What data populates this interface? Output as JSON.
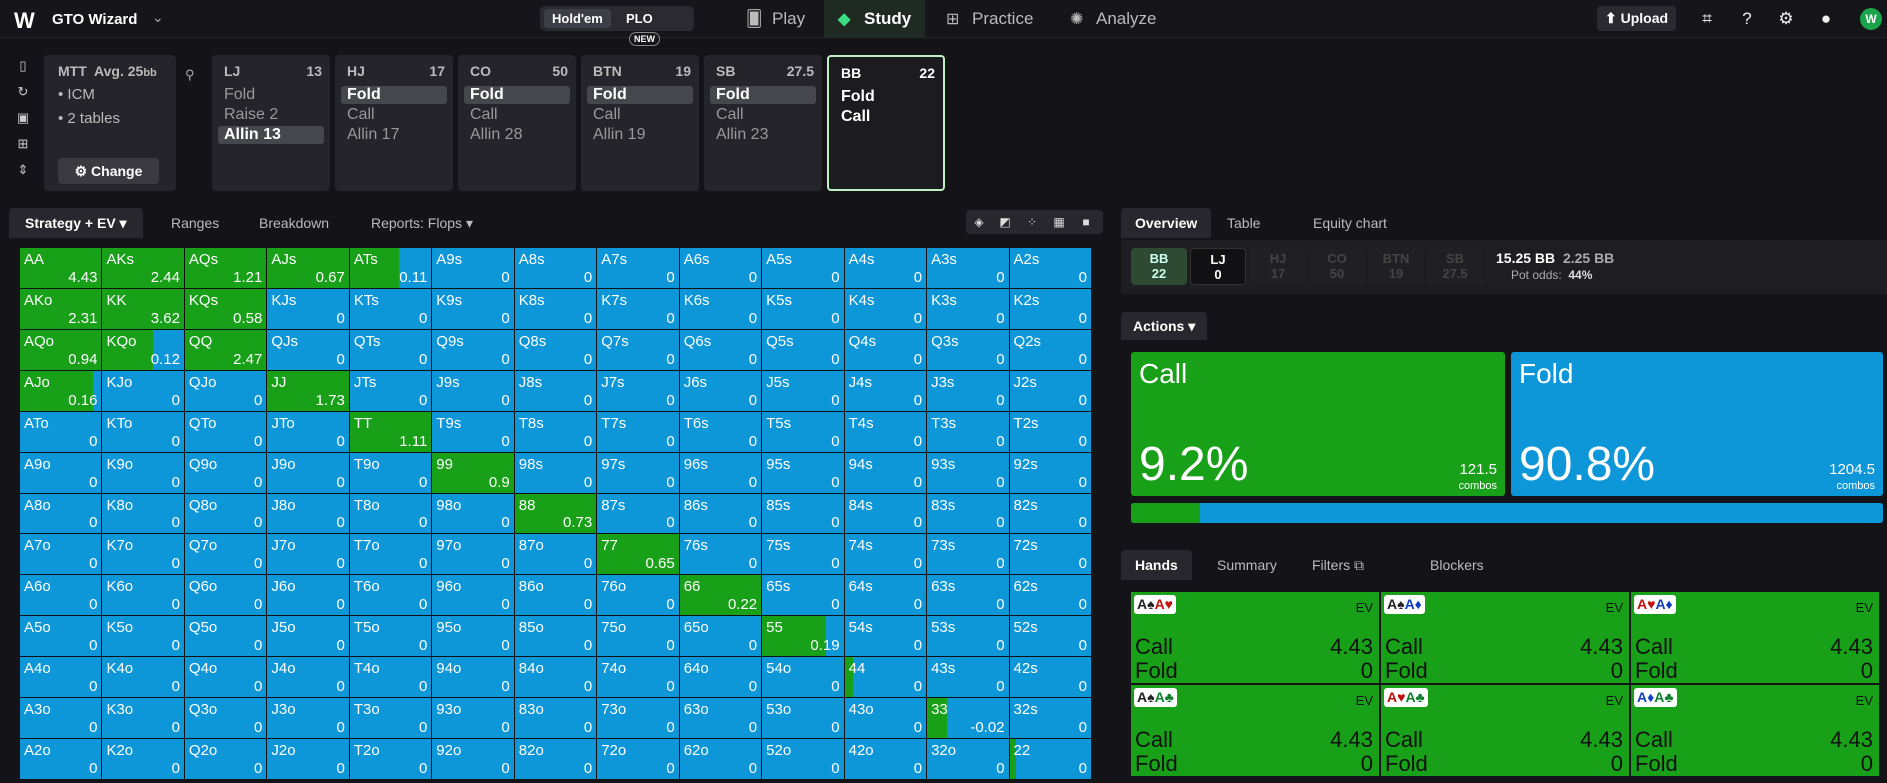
{
  "app": {
    "logo": "W",
    "name": "GTO Wizard"
  },
  "game_toggle": {
    "holdem": "Hold'em",
    "plo": "PLO",
    "new_badge": "NEW"
  },
  "nav": [
    {
      "label": "Play",
      "icon": "cards-icon"
    },
    {
      "label": "Study",
      "icon": "graduation-cap-icon"
    },
    {
      "label": "Practice",
      "icon": "gamepad-icon"
    },
    {
      "label": "Analyze",
      "icon": "lightbulb-icon"
    }
  ],
  "upload_label": "Upload",
  "avatar_initial": "W",
  "tournament": {
    "title": "MTT",
    "avg": "Avg. 25",
    "avg_unit": "bb",
    "bullets": [
      "ICM",
      "2 tables"
    ],
    "change_label": "Change"
  },
  "positions": [
    {
      "name": "LJ",
      "stack": "13",
      "actions": [
        "Fold",
        "Raise 2",
        "Allin 13"
      ],
      "selected": 2
    },
    {
      "name": "HJ",
      "stack": "17",
      "actions": [
        "Fold",
        "Call",
        "Allin 17"
      ],
      "selected": 0
    },
    {
      "name": "CO",
      "stack": "50",
      "actions": [
        "Fold",
        "Call",
        "Allin 28"
      ],
      "selected": 0
    },
    {
      "name": "BTN",
      "stack": "19",
      "actions": [
        "Fold",
        "Call",
        "Allin 19"
      ],
      "selected": 0
    },
    {
      "name": "SB",
      "stack": "27.5",
      "actions": [
        "Fold",
        "Call",
        "Allin 23"
      ],
      "selected": 0
    },
    {
      "name": "BB",
      "stack": "22",
      "actions": [
        "Fold",
        "Call"
      ],
      "selected": -1,
      "current": true
    }
  ],
  "left_tabs": [
    "Strategy + EV",
    "Ranges",
    "Breakdown",
    "Reports: Flops"
  ],
  "grid": {
    "hands": [
      [
        "AA",
        "AKs",
        "AQs",
        "AJs",
        "ATs",
        "A9s",
        "A8s",
        "A7s",
        "A6s",
        "A5s",
        "A4s",
        "A3s",
        "A2s"
      ],
      [
        "AKo",
        "KK",
        "KQs",
        "KJs",
        "KTs",
        "K9s",
        "K8s",
        "K7s",
        "K6s",
        "K5s",
        "K4s",
        "K3s",
        "K2s"
      ],
      [
        "AQo",
        "KQo",
        "QQ",
        "QJs",
        "QTs",
        "Q9s",
        "Q8s",
        "Q7s",
        "Q6s",
        "Q5s",
        "Q4s",
        "Q3s",
        "Q2s"
      ],
      [
        "AJo",
        "KJo",
        "QJo",
        "JJ",
        "JTs",
        "J9s",
        "J8s",
        "J7s",
        "J6s",
        "J5s",
        "J4s",
        "J3s",
        "J2s"
      ],
      [
        "ATo",
        "KTo",
        "QTo",
        "JTo",
        "TT",
        "T9s",
        "T8s",
        "T7s",
        "T6s",
        "T5s",
        "T4s",
        "T3s",
        "T2s"
      ],
      [
        "A9o",
        "K9o",
        "Q9o",
        "J9o",
        "T9o",
        "99",
        "98s",
        "97s",
        "96s",
        "95s",
        "94s",
        "93s",
        "92s"
      ],
      [
        "A8o",
        "K8o",
        "Q8o",
        "J8o",
        "T8o",
        "98o",
        "88",
        "87s",
        "86s",
        "85s",
        "84s",
        "83s",
        "82s"
      ],
      [
        "A7o",
        "K7o",
        "Q7o",
        "J7o",
        "T7o",
        "97o",
        "87o",
        "77",
        "76s",
        "75s",
        "74s",
        "73s",
        "72s"
      ],
      [
        "A6o",
        "K6o",
        "Q6o",
        "J6o",
        "T6o",
        "96o",
        "86o",
        "76o",
        "66",
        "65s",
        "64s",
        "63s",
        "62s"
      ],
      [
        "A5o",
        "K5o",
        "Q5o",
        "J5o",
        "T5o",
        "95o",
        "85o",
        "75o",
        "65o",
        "55",
        "54s",
        "53s",
        "52s"
      ],
      [
        "A4o",
        "K4o",
        "Q4o",
        "J4o",
        "T4o",
        "94o",
        "84o",
        "74o",
        "64o",
        "54o",
        "44",
        "43s",
        "42s"
      ],
      [
        "A3o",
        "K3o",
        "Q3o",
        "J3o",
        "T3o",
        "93o",
        "83o",
        "73o",
        "63o",
        "53o",
        "43o",
        "33",
        "32s"
      ],
      [
        "A2o",
        "K2o",
        "Q2o",
        "J2o",
        "T2o",
        "92o",
        "82o",
        "72o",
        "62o",
        "52o",
        "42o",
        "32o",
        "22"
      ]
    ],
    "ev": [
      [
        "4.43",
        "2.44",
        "1.21",
        "0.67",
        "0.11",
        "0",
        "0",
        "0",
        "0",
        "0",
        "0",
        "0",
        "0"
      ],
      [
        "2.31",
        "3.62",
        "0.58",
        "0",
        "0",
        "0",
        "0",
        "0",
        "0",
        "0",
        "0",
        "0",
        "0"
      ],
      [
        "0.94",
        "0.12",
        "2.47",
        "0",
        "0",
        "0",
        "0",
        "0",
        "0",
        "0",
        "0",
        "0",
        "0"
      ],
      [
        "0.16",
        "0",
        "0",
        "1.73",
        "0",
        "0",
        "0",
        "0",
        "0",
        "0",
        "0",
        "0",
        "0"
      ],
      [
        "0",
        "0",
        "0",
        "0",
        "1.11",
        "0",
        "0",
        "0",
        "0",
        "0",
        "0",
        "0",
        "0"
      ],
      [
        "0",
        "0",
        "0",
        "0",
        "0",
        "0.9",
        "0",
        "0",
        "0",
        "0",
        "0",
        "0",
        "0"
      ],
      [
        "0",
        "0",
        "0",
        "0",
        "0",
        "0",
        "0.73",
        "0",
        "0",
        "0",
        "0",
        "0",
        "0"
      ],
      [
        "0",
        "0",
        "0",
        "0",
        "0",
        "0",
        "0",
        "0.65",
        "0",
        "0",
        "0",
        "0",
        "0"
      ],
      [
        "0",
        "0",
        "0",
        "0",
        "0",
        "0",
        "0",
        "0",
        "0.22",
        "0",
        "0",
        "0",
        "0"
      ],
      [
        "0",
        "0",
        "0",
        "0",
        "0",
        "0",
        "0",
        "0",
        "0",
        "0.19",
        "0",
        "0",
        "0"
      ],
      [
        "0",
        "0",
        "0",
        "0",
        "0",
        "0",
        "0",
        "0",
        "0",
        "0",
        "0",
        "0",
        "0"
      ],
      [
        "0",
        "0",
        "0",
        "0",
        "0",
        "0",
        "0",
        "0",
        "0",
        "0",
        "0",
        "-0.02",
        "0"
      ],
      [
        "0",
        "0",
        "0",
        "0",
        "0",
        "0",
        "0",
        "0",
        "0",
        "0",
        "0",
        "0",
        "0"
      ]
    ],
    "call_freq": [
      [
        1,
        1,
        1,
        1,
        0.6,
        0,
        0,
        0,
        0,
        0,
        0,
        0,
        0
      ],
      [
        1,
        1,
        1,
        0,
        0,
        0,
        0,
        0,
        0,
        0,
        0,
        0,
        0
      ],
      [
        1,
        0.62,
        1,
        0,
        0,
        0,
        0,
        0,
        0,
        0,
        0,
        0,
        0
      ],
      [
        0.9,
        0,
        0,
        1,
        0,
        0,
        0,
        0,
        0,
        0,
        0,
        0,
        0
      ],
      [
        0,
        0,
        0,
        0,
        1,
        0,
        0,
        0,
        0,
        0,
        0,
        0,
        0
      ],
      [
        0,
        0,
        0,
        0,
        0,
        1,
        0,
        0,
        0,
        0,
        0,
        0,
        0
      ],
      [
        0,
        0,
        0,
        0,
        0,
        0,
        1,
        0,
        0,
        0,
        0,
        0,
        0
      ],
      [
        0,
        0,
        0,
        0,
        0,
        0,
        0,
        1,
        0,
        0,
        0,
        0,
        0
      ],
      [
        0,
        0,
        0,
        0,
        0,
        0,
        0,
        0,
        1,
        0,
        0,
        0,
        0
      ],
      [
        0,
        0,
        0,
        0,
        0,
        0,
        0,
        0,
        0,
        0.78,
        0,
        0,
        0
      ],
      [
        0,
        0,
        0,
        0,
        0,
        0,
        0,
        0,
        0,
        0,
        0.1,
        0,
        0
      ],
      [
        0,
        0,
        0,
        0,
        0,
        0,
        0,
        0,
        0,
        0,
        0,
        0.25,
        0
      ],
      [
        0,
        0,
        0,
        0,
        0,
        0,
        0,
        0,
        0,
        0,
        0,
        0,
        0.08
      ]
    ]
  },
  "right_tabs": [
    "Overview",
    "Table",
    "Equity chart"
  ],
  "chips": [
    {
      "name": "BB",
      "value": "22"
    },
    {
      "name": "LJ",
      "value": "0"
    },
    {
      "name": "HJ",
      "value": "17"
    },
    {
      "name": "CO",
      "value": "50"
    },
    {
      "name": "BTN",
      "value": "19"
    },
    {
      "name": "SB",
      "value": "27.5"
    }
  ],
  "pot": {
    "main": "15.25 BB",
    "call": "2.25 BB",
    "odds_label": "Pot odds:",
    "odds": "44%"
  },
  "actions_label": "Actions",
  "action_summary": [
    {
      "name": "Call",
      "pct": "9.2%",
      "combos": "121.5",
      "combos_label": "combos",
      "color": "#18a018"
    },
    {
      "name": "Fold",
      "pct": "90.8%",
      "combos": "1204.5",
      "combos_label": "combos",
      "color": "#0d96d8"
    }
  ],
  "call_fraction": 0.092,
  "hand_tabs": [
    "Hands",
    "Summary",
    "Filters",
    "Blockers"
  ],
  "combos": [
    {
      "c1": "A♠",
      "c2": "A♥",
      "c1color": "blk",
      "c2color": "red"
    },
    {
      "c1": "A♠",
      "c2": "A♦",
      "c1color": "blk",
      "c2color": "blu"
    },
    {
      "c1": "A♥",
      "c2": "A♦",
      "c1color": "red",
      "c2color": "blu"
    },
    {
      "c1": "A♠",
      "c2": "A♣",
      "c1color": "blk",
      "c2color": "grn"
    },
    {
      "c1": "A♥",
      "c2": "A♣",
      "c1color": "red",
      "c2color": "grn"
    },
    {
      "c1": "A♦",
      "c2": "A♣",
      "c1color": "blu",
      "c2color": "grn"
    }
  ],
  "combo_ev_label": "EV",
  "combo_rows": [
    {
      "label": "Call",
      "value": "4.43"
    },
    {
      "label": "Fold",
      "value": "0"
    }
  ]
}
